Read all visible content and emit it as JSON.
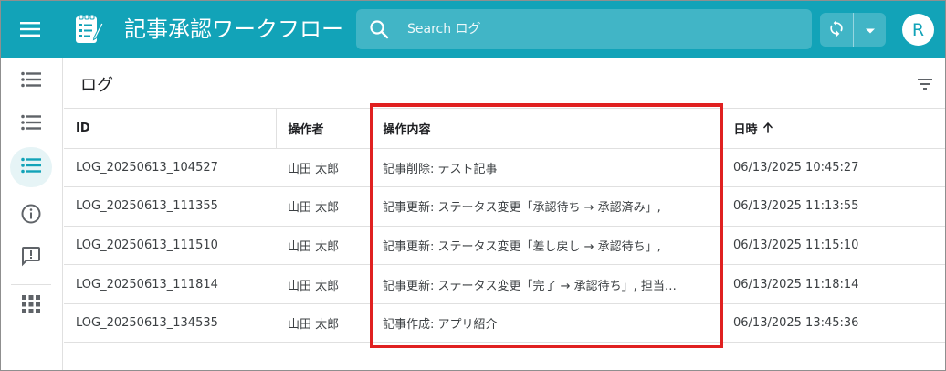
{
  "header": {
    "app_title": "記事承認ワークフロー",
    "search_placeholder": "Search ログ",
    "avatar_initial": "R",
    "brand_color": "#12a3b8"
  },
  "icons": {
    "menu": "hamburger-menu-icon",
    "logo": "notepad-pencil-icon",
    "search": "search-icon",
    "sync": "sync-icon",
    "dropdown": "caret-down-icon",
    "filter": "filter-icon",
    "sort": "arrow-up-icon"
  },
  "sidebar": {
    "items": [
      {
        "icon": "list-icon",
        "active": false
      },
      {
        "icon": "list-icon",
        "active": false
      },
      {
        "icon": "list-icon",
        "active": true
      },
      {
        "icon": "info-icon",
        "active": false
      },
      {
        "icon": "feedback-icon",
        "active": false
      },
      {
        "icon": "apps-grid-icon",
        "active": false
      }
    ]
  },
  "panel": {
    "title": "ログ"
  },
  "table": {
    "columns": [
      "ID",
      "操作者",
      "操作内容",
      "日時"
    ],
    "sort_column": "日時",
    "sort_direction": "ascending",
    "rows": [
      {
        "id": "LOG_20250613_104527",
        "operator": "山田 太郎",
        "description": "記事削除: テスト記事",
        "datetime": "06/13/2025 10:45:27"
      },
      {
        "id": "LOG_20250613_111355",
        "operator": "山田 太郎",
        "description": "記事更新: ステータス変更「承認待ち → 承認済み」,",
        "datetime": "06/13/2025 11:13:55"
      },
      {
        "id": "LOG_20250613_111510",
        "operator": "山田 太郎",
        "description": "記事更新: ステータス変更「差し戻し → 承認待ち」,",
        "datetime": "06/13/2025 11:15:10"
      },
      {
        "id": "LOG_20250613_111814",
        "operator": "山田 太郎",
        "description": "記事更新: ステータス変更「完了 → 承認待ち」, 担当…",
        "datetime": "06/13/2025 11:18:14"
      },
      {
        "id": "LOG_20250613_134535",
        "operator": "山田 太郎",
        "description": "記事作成: アプリ紹介",
        "datetime": "06/13/2025 13:45:36"
      }
    ]
  },
  "highlight_color": "#e02020"
}
